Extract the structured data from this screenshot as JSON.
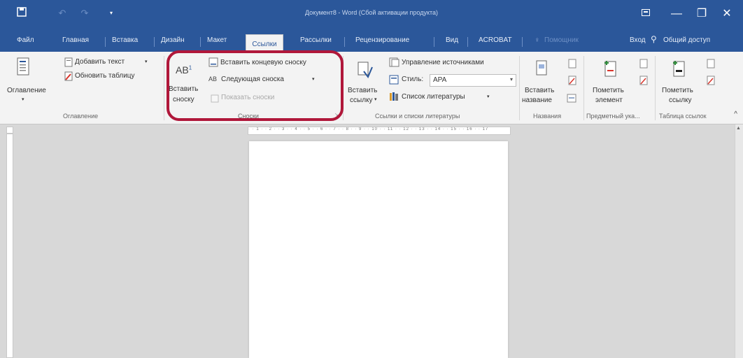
{
  "window": {
    "title": "Документ8 - Word (Сбой активации продукта)",
    "minimize_icon": "minimize-icon",
    "restore_icon": "restore-icon",
    "close_icon": "close-icon"
  },
  "tabs": {
    "file": "Файл",
    "home": "Главная",
    "insert": "Вставка",
    "design": "Дизайн",
    "layout": "Макет",
    "references": "Ссылки",
    "mailings": "Рассылки",
    "review": "Рецензирование",
    "view": "Вид",
    "acrobat": "ACROBAT",
    "tell_me": "Помощник",
    "sign_in": "Вход",
    "share": "Общий доступ"
  },
  "ribbon": {
    "toc": {
      "toc_label": "Оглавление",
      "add_text": "Добавить текст",
      "update_table": "Обновить таблицу",
      "group": "Оглавление"
    },
    "footnotes": {
      "insert_footnote_1": "Вставить",
      "insert_footnote_2": "сноску",
      "insert_endnote": "Вставить концевую сноску",
      "next_footnote": "Следующая сноска",
      "show_notes": "Показать сноски",
      "group": "Сноски",
      "ab_glyph": "AB",
      "ab_sup": "1",
      "next_glyph": "AB"
    },
    "citations": {
      "insert_citation_1": "Вставить",
      "insert_citation_2": "ссылку",
      "manage_sources": "Управление источниками",
      "style_label": "Стиль:",
      "style_value": "APA",
      "bibliography": "Список литературы",
      "group": "Ссылки и списки литературы"
    },
    "captions": {
      "insert_caption_1": "Вставить",
      "insert_caption_2": "название",
      "group": "Названия"
    },
    "index": {
      "mark_entry_1": "Пометить",
      "mark_entry_2": "элемент",
      "group": "Предметный ука..."
    },
    "toa": {
      "mark_citation_1": "Пометить",
      "mark_citation_2": "ссылку",
      "group": "Таблица ссылок"
    }
  },
  "ruler": {
    "marks": "· · 1 · · 2 · · 3 · · 4 · · 5 · · 6 · · 7 · · 8 · · 9 · · 10 · · 11 · · 12 · · 13 · · 14 · · 15 · · 16 · · 17"
  },
  "colors": {
    "accent": "#2b579a",
    "highlight": "#b0173a"
  }
}
